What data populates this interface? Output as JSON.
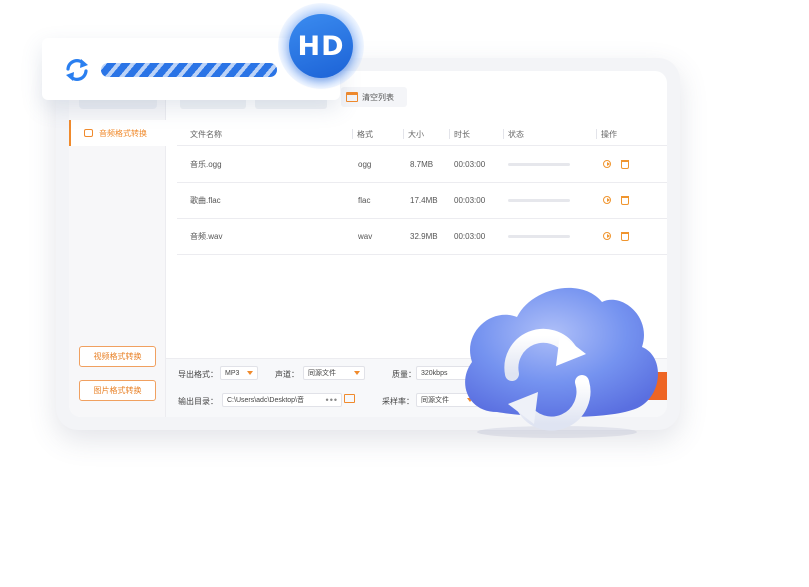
{
  "floating_badge": {
    "quality_label": "HD"
  },
  "sidebar": {
    "active_item": "音频格式转换",
    "bottom_items": [
      "视频格式转换",
      "图片格式转换"
    ]
  },
  "toolbar": {
    "clear_label": "清空列表"
  },
  "table": {
    "headers": [
      "文件名称",
      "格式",
      "大小",
      "时长",
      "状态",
      "操作"
    ],
    "rows": [
      {
        "name": "音乐.ogg",
        "format": "ogg",
        "size": "8.7MB",
        "duration": "00:03:00",
        "progress": 0
      },
      {
        "name": "歌曲.flac",
        "format": "flac",
        "size": "17.4MB",
        "duration": "00:03:00",
        "progress": 0
      },
      {
        "name": "音频.wav",
        "format": "wav",
        "size": "32.9MB",
        "duration": "00:03:00",
        "progress": 0
      }
    ]
  },
  "settings": {
    "export_format_label": "导出格式：",
    "export_format_value": "MP3",
    "channel_label": "声道：",
    "channel_value": "同源文件",
    "quality_label": "质量：",
    "quality_value": "320kbps",
    "output_dir_label": "输出目录：",
    "output_dir_value": "C:\\Users\\adc\\Desktop\\音",
    "output_dir_more": "•••",
    "sample_rate_label": "采样率：",
    "sample_rate_value": "同源文件"
  },
  "colors": {
    "accent": "#f08a2c",
    "convert": "#ee6524",
    "brand_blue": "#2a74e6",
    "cloud": "#6e8ff3"
  }
}
